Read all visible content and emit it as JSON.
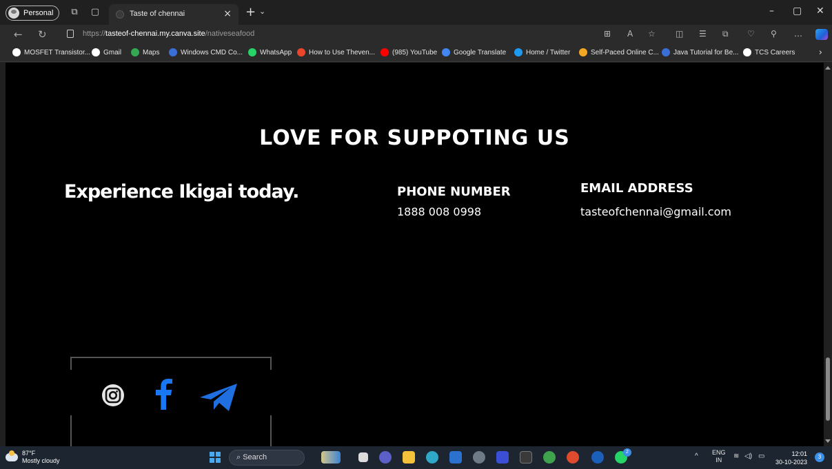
{
  "browser": {
    "profile_label": "Personal",
    "tab_title": "Taste of chennai",
    "url_scheme": "https://",
    "url_host": "tasteof-chennai.my.canva.site",
    "url_path": "/nativeseafood"
  },
  "bookmarks": [
    {
      "label": "MOSFET Transistor...",
      "icon": "wordpress-icon",
      "color": "#ffffff"
    },
    {
      "label": "Gmail",
      "icon": "google-icon",
      "color": "#ffffff"
    },
    {
      "label": "Maps",
      "icon": "maps-icon",
      "color": "#34a853"
    },
    {
      "label": "Windows CMD Co...",
      "icon": "globe-icon",
      "color": "#3b6fd8"
    },
    {
      "label": "WhatsApp",
      "icon": "whatsapp-icon",
      "color": "#25d366"
    },
    {
      "label": "How to Use Theven...",
      "icon": "video-icon",
      "color": "#e8452c"
    },
    {
      "label": "(985) YouTube",
      "icon": "youtube-icon",
      "color": "#ff0000"
    },
    {
      "label": "Google Translate",
      "icon": "translate-icon",
      "color": "#4285f4"
    },
    {
      "label": "Home / Twitter",
      "icon": "twitter-icon",
      "color": "#1d9bf0"
    },
    {
      "label": "Self-Paced Online C...",
      "icon": "course-icon",
      "color": "#f5a623"
    },
    {
      "label": "Java Tutorial for Be...",
      "icon": "java-icon",
      "color": "#3b6fd8"
    },
    {
      "label": "TCS Careers",
      "icon": "page-icon",
      "color": "#ffffff"
    }
  ],
  "page": {
    "heading": "LOVE FOR SUPPOTING US",
    "tagline": "Experience Ikigai today.",
    "phone_heading": "PHONE NUMBER",
    "phone_value": "1888 008 0998",
    "email_heading": "EMAIL ADDRESS",
    "email_value": "tasteofchennai@gmail.com",
    "social": [
      {
        "name": "instagram-icon",
        "color": "#e6e6e6"
      },
      {
        "name": "facebook-icon",
        "color": "#1877f2"
      },
      {
        "name": "telegram-icon",
        "color": "#1f6fe0"
      }
    ]
  },
  "taskbar": {
    "temperature": "87°F",
    "weather": "Mostly cloudy",
    "search_label": "Search",
    "lang_top": "ENG",
    "lang_bottom": "IN",
    "time": "12:01",
    "date": "30-10-2023",
    "notification_count": "3",
    "whatsapp_badge": "2"
  }
}
